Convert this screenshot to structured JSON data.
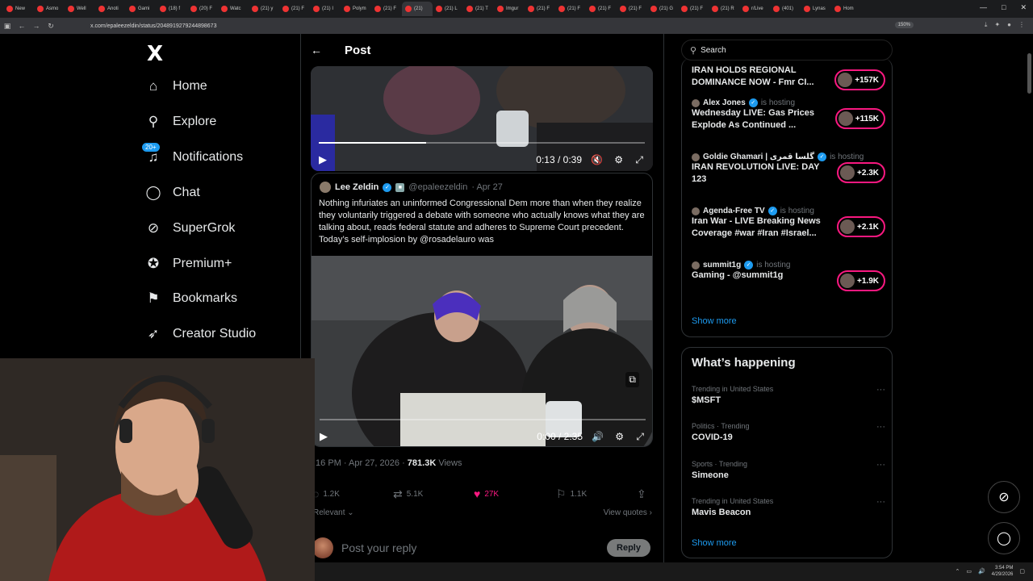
{
  "browser": {
    "tabs": [
      {
        "label": "New"
      },
      {
        "label": "Asmo"
      },
      {
        "label": "Well"
      },
      {
        "label": "Anoti"
      },
      {
        "label": "Gami"
      },
      {
        "label": "(18) f"
      },
      {
        "label": "(20) F"
      },
      {
        "label": "Watc"
      },
      {
        "label": "(21) y"
      },
      {
        "label": "(21) F"
      },
      {
        "label": "(21) I"
      },
      {
        "label": "Polym"
      },
      {
        "label": "(21) F"
      },
      {
        "label": "(21)"
      },
      {
        "label": "(21) L"
      },
      {
        "label": "(21) T"
      },
      {
        "label": "Imgur"
      },
      {
        "label": "(21) F"
      },
      {
        "label": "(21) F"
      },
      {
        "label": "(21) F"
      },
      {
        "label": "(21) F"
      },
      {
        "label": "(21) G"
      },
      {
        "label": "(21) F"
      },
      {
        "label": "(21) R"
      },
      {
        "label": "r/Live"
      },
      {
        "label": "(401)"
      },
      {
        "label": "Lynas"
      },
      {
        "label": "Hom"
      }
    ],
    "url": "x.com/epaleezeldin/status/2048919279244898673",
    "zoom": "150%"
  },
  "nav": {
    "logo": "X",
    "items": [
      {
        "label": "Home",
        "icon": "home-icon"
      },
      {
        "label": "Explore",
        "icon": "search-icon"
      },
      {
        "label": "Notifications",
        "icon": "bell-icon",
        "badge": "20+"
      },
      {
        "label": "Chat",
        "icon": "chat-icon"
      },
      {
        "label": "SuperGrok",
        "icon": "grok-icon"
      },
      {
        "label": "Premium+",
        "icon": "verified-icon"
      },
      {
        "label": "Bookmarks",
        "icon": "bookmark-icon"
      },
      {
        "label": "Creator Studio",
        "icon": "rocket-icon"
      }
    ]
  },
  "post": {
    "header_title": "Post",
    "video1": {
      "time": "0:13 / 0:39",
      "progress": 0.33
    },
    "quote": {
      "name": "Lee Zeldin",
      "handle": "@epaleezeldin",
      "date": "· Apr 27",
      "text": "Nothing infuriates an uninformed Congressional Dem more than when they realize they voluntarily triggered a debate with someone who actually knows what they are talking about, reads federal statute and adheres to Supreme Court precedent. Today’s self-implosion by @rosadelauro was"
    },
    "video2": {
      "time": "0:00 / 2:35",
      "progress": 0.0
    },
    "meta_time": ":16 PM · Apr 27, 2026 · ",
    "views_count": "781.3K",
    "views_label": " Views",
    "actions": {
      "replies": "1.2K",
      "reposts": "5.1K",
      "likes": "27K",
      "bookmarks": "1.1K"
    },
    "relevant_label": "Relevant",
    "view_quotes_label": "View quotes",
    "reply_placeholder": "Post your reply",
    "reply_button": "Reply"
  },
  "sidebar": {
    "search_placeholder": "Search",
    "spaces": [
      {
        "host": "",
        "hosting": "",
        "title": "IRAN HOLDS REGIONAL DOMINANCE NOW - Fmr CI...",
        "count": "+157K"
      },
      {
        "host": "Alex Jones",
        "hosting": "is hosting",
        "title": "Wednesday LIVE: Gas Prices Explode As Continued ...",
        "count": "+115K"
      },
      {
        "host": "Goldie Ghamari | گلسا قمری",
        "hosting": "is hosting",
        "title": "IRAN REVOLUTION LIVE: DAY 123",
        "count": "+2.3K"
      },
      {
        "host": "Agenda-Free TV",
        "hosting": "is hosting",
        "title": "Iran War - LIVE Breaking News Coverage #war #Iran #Israel...",
        "count": "+2.1K"
      },
      {
        "host": "summit1g",
        "hosting": "is hosting",
        "title": "Gaming - @summit1g",
        "count": "+1.9K"
      }
    ],
    "spaces_show_more": "Show more",
    "happening_title": "What’s happening",
    "trends": [
      {
        "context": "Trending in United States",
        "name": "$MSFT"
      },
      {
        "context": "Politics · Trending",
        "name": "COVID-19"
      },
      {
        "context": "Sports · Trending",
        "name": "Simeone"
      },
      {
        "context": "Trending in United States",
        "name": "Mavis Beacon"
      }
    ],
    "trends_show_more": "Show more"
  },
  "taskbar": {
    "time": "3:54 PM",
    "date": "4/29/2026"
  },
  "colors": {
    "accent": "#1d9bf0",
    "like": "#f91880",
    "bg": "#000000",
    "border": "#2f3336",
    "muted": "#71767b"
  }
}
